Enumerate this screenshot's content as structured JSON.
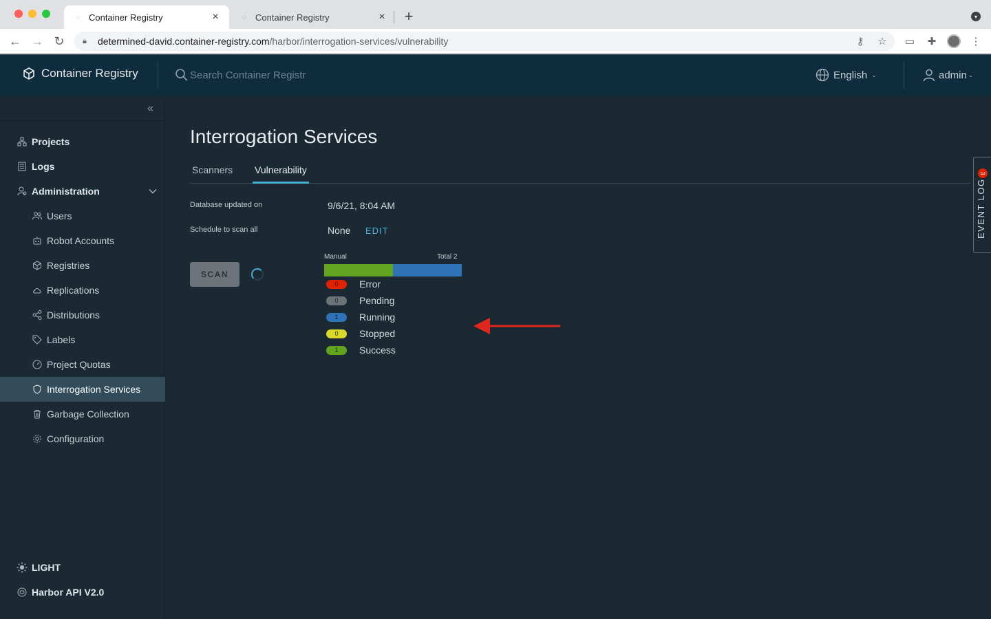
{
  "browser": {
    "tabs": [
      {
        "title": "Container Registry",
        "active": true
      },
      {
        "title": "Container Registry",
        "active": false
      }
    ],
    "url_host": "determined-david.container-registry.com",
    "url_path": "/harbor/interrogation-services/vulnerability"
  },
  "header": {
    "brand": "Container Registry",
    "search_placeholder": "Search Container Registr",
    "language": "English",
    "user": "admin"
  },
  "sidebar": {
    "items": [
      {
        "label": "Projects"
      },
      {
        "label": "Logs"
      },
      {
        "label": "Administration"
      },
      {
        "label": "Users"
      },
      {
        "label": "Robot Accounts"
      },
      {
        "label": "Registries"
      },
      {
        "label": "Replications"
      },
      {
        "label": "Distributions"
      },
      {
        "label": "Labels"
      },
      {
        "label": "Project Quotas"
      },
      {
        "label": "Interrogation Services"
      },
      {
        "label": "Garbage Collection"
      },
      {
        "label": "Configuration"
      }
    ],
    "theme_toggle": "LIGHT",
    "api_link": "Harbor API V2.0"
  },
  "main": {
    "title": "Interrogation Services",
    "tabs": [
      "Scanners",
      "Vulnerability"
    ],
    "db_updated_label": "Database updated on",
    "db_updated_value": "9/6/21, 8:04 AM",
    "schedule_label": "Schedule to scan all",
    "schedule_value": "None",
    "edit_label": "EDIT",
    "scan_button": "SCAN",
    "progress": {
      "trigger": "Manual",
      "total_label": "Total",
      "total": "2",
      "legend": [
        {
          "name": "Error",
          "count": "0",
          "color": "#e02200",
          "text_color": "#3b0a00"
        },
        {
          "name": "Pending",
          "count": "0",
          "color": "#6c7479",
          "text_color": "#1f272b"
        },
        {
          "name": "Running",
          "count": "1",
          "color": "#2f72b5",
          "text_color": "#0a1f33"
        },
        {
          "name": "Stopped",
          "count": "0",
          "color": "#d9d92a",
          "text_color": "#333300"
        },
        {
          "name": "Success",
          "count": "1",
          "color": "#62a420",
          "text_color": "#0f2a00"
        }
      ]
    }
  },
  "event_log": {
    "label": "EVENT LOG",
    "count": "3"
  }
}
